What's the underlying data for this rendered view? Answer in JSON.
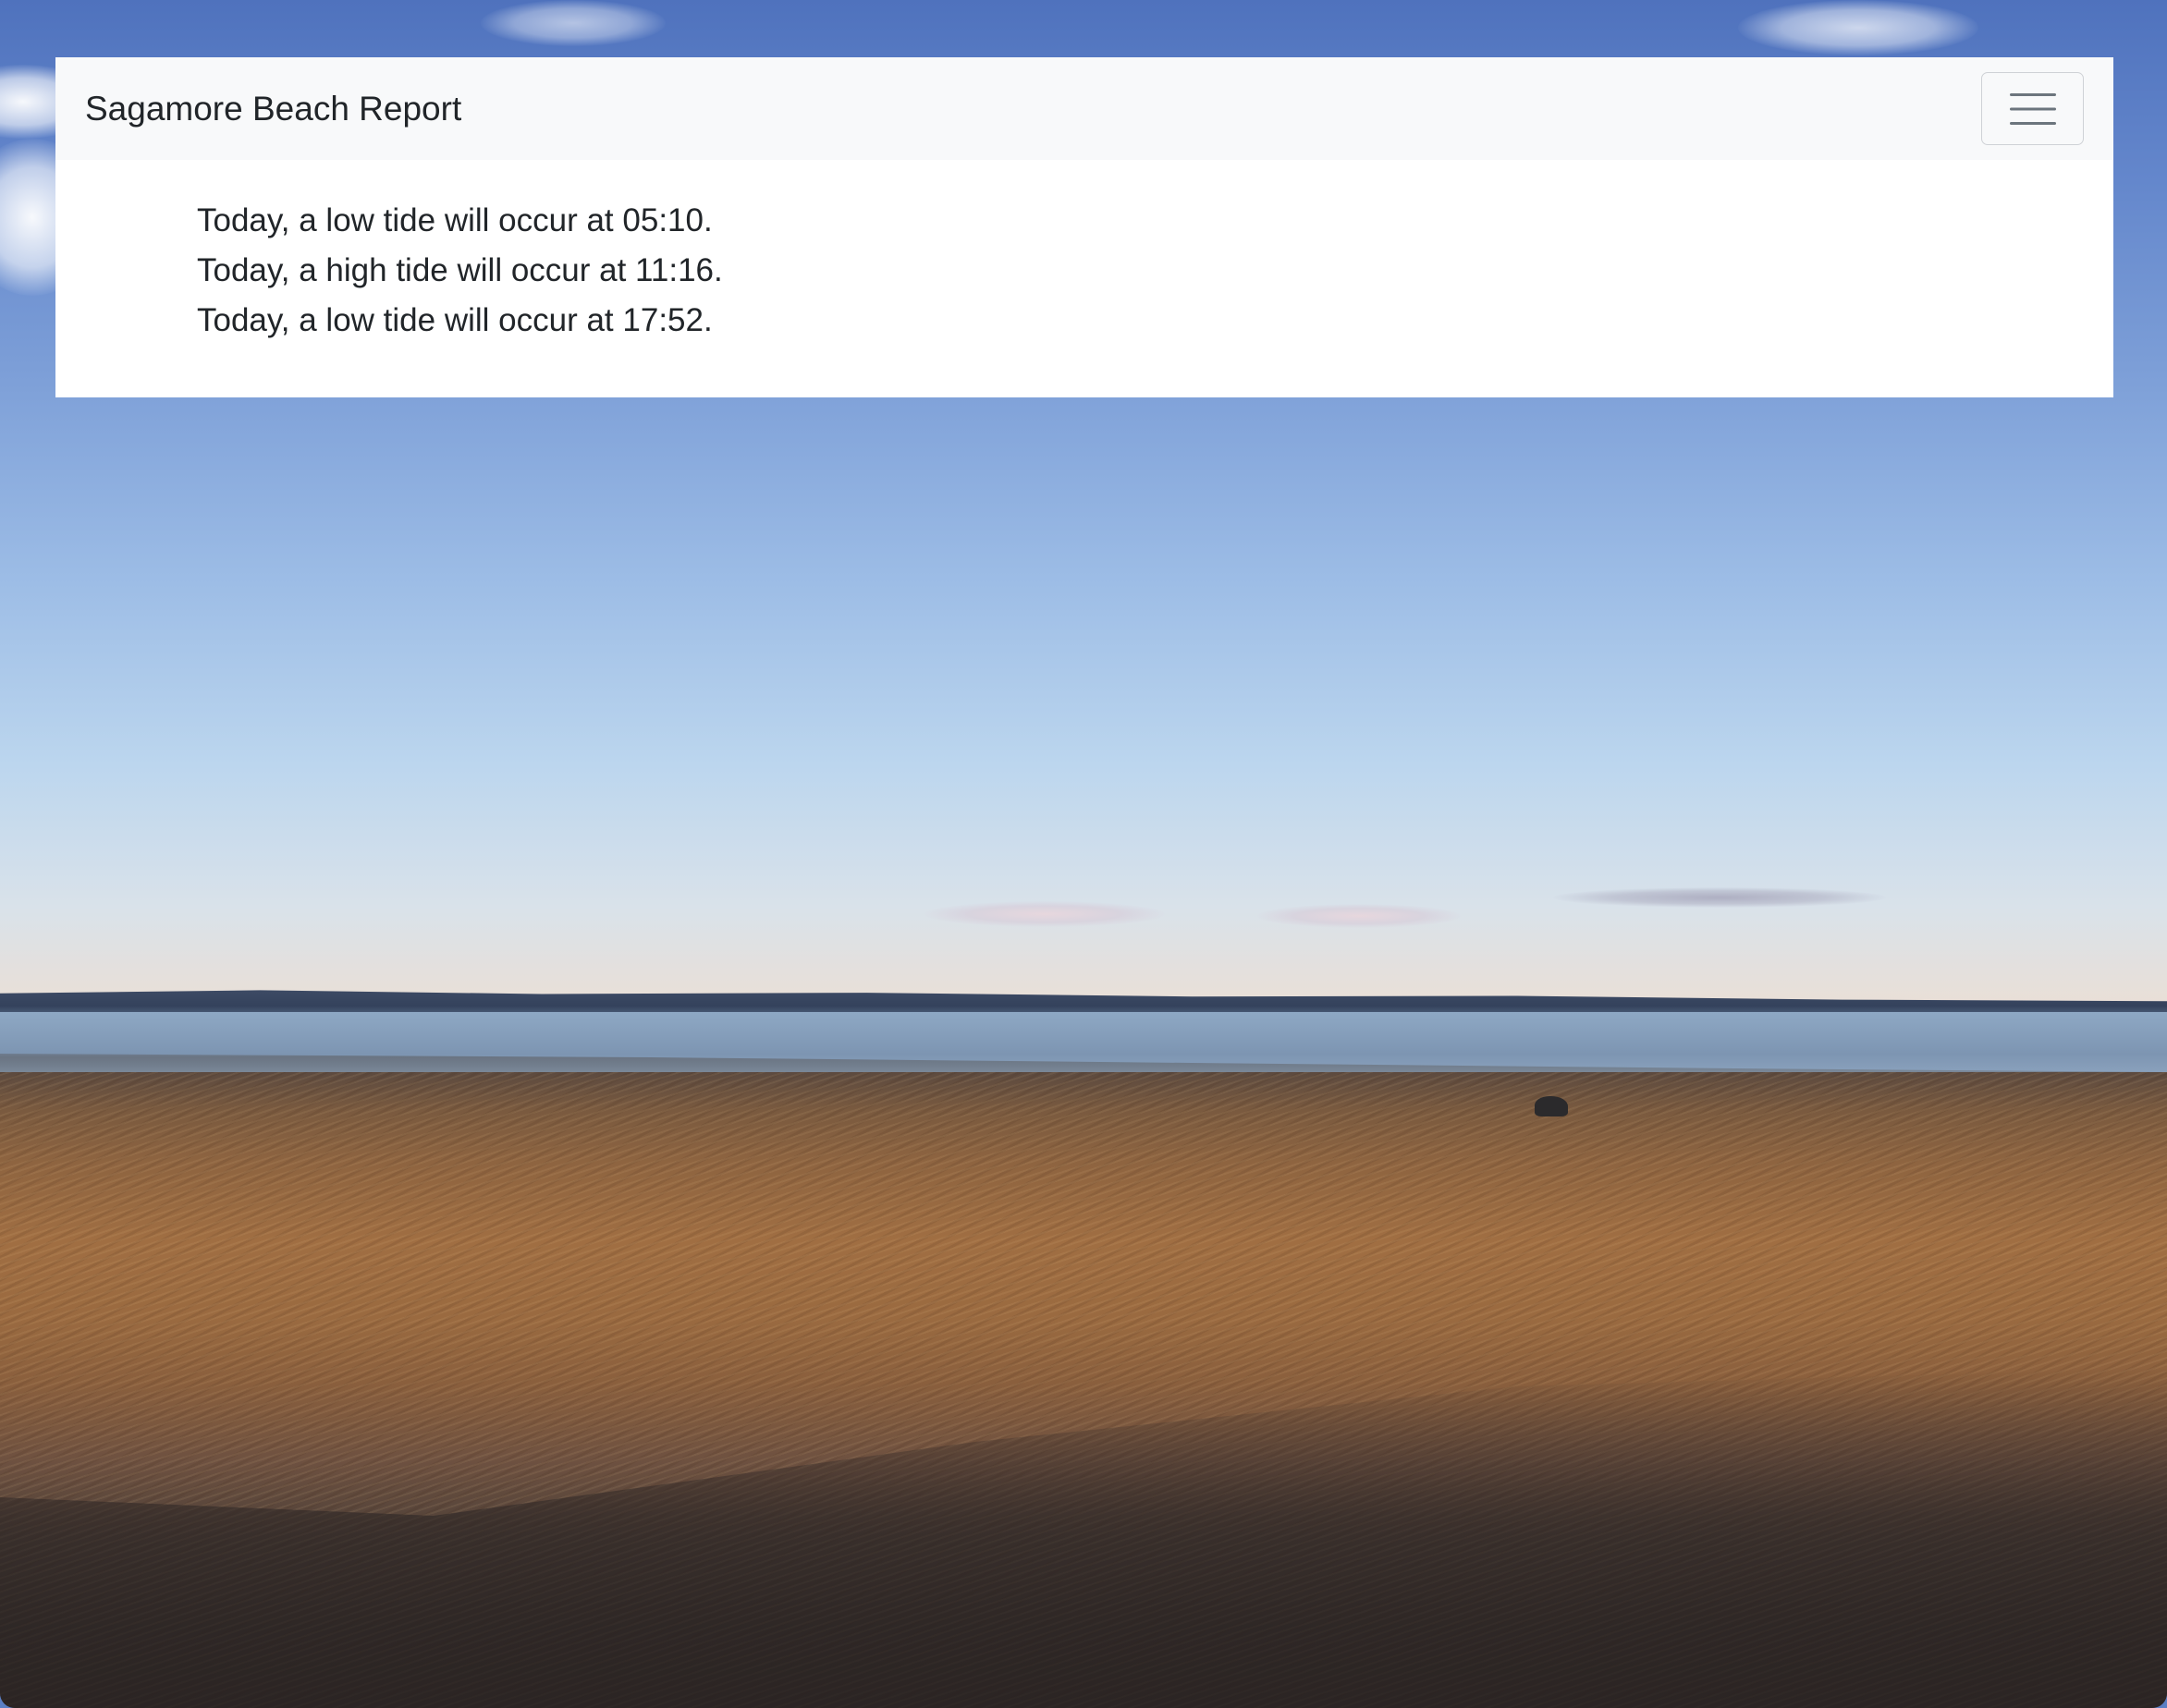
{
  "navbar": {
    "brand": "Sagamore Beach Report",
    "toggler_icon": "hamburger-menu-icon"
  },
  "tides": [
    {
      "text": "Today, a low tide will occur at 05:10."
    },
    {
      "text": "Today, a high tide will occur at 11:16."
    },
    {
      "text": "Today, a low tide will occur at 17:52."
    }
  ],
  "colors": {
    "navbar_bg": "#f8f9fa",
    "card_bg": "#ffffff",
    "text": "#212529",
    "toggler_border": "#cfd2d6",
    "toggler_icon": "#6c757d"
  }
}
